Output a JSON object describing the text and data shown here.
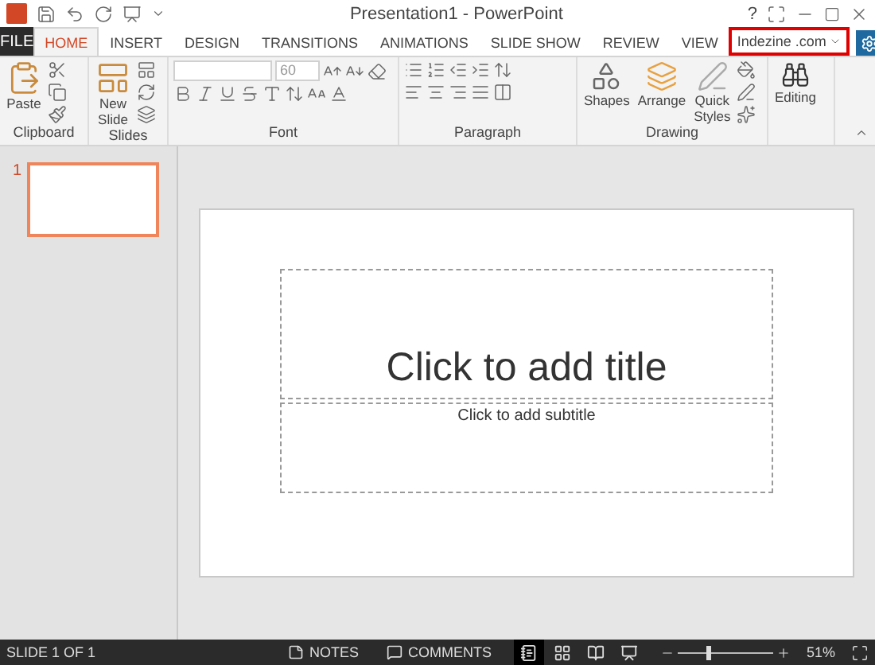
{
  "window": {
    "title": "Presentation1 - PowerPoint",
    "help": "?"
  },
  "file_tab": "FILE",
  "tabs": [
    {
      "label": "HOME",
      "selected": true
    },
    {
      "label": "INSERT",
      "selected": false
    },
    {
      "label": "DESIGN",
      "selected": false
    },
    {
      "label": "TRANSITIONS",
      "selected": false
    },
    {
      "label": "ANIMATIONS",
      "selected": false
    },
    {
      "label": "SLIDE SHOW",
      "selected": false
    },
    {
      "label": "REVIEW",
      "selected": false
    },
    {
      "label": "VIEW",
      "selected": false
    }
  ],
  "account": {
    "name": "Indezine .com",
    "highlighted": true
  },
  "ribbon": {
    "groups": [
      {
        "kind": "clipboard",
        "label": "Clipboard",
        "buttons": [
          "Paste"
        ]
      },
      {
        "kind": "slides",
        "label": "Slides",
        "buttons": [
          "New",
          "Slide"
        ]
      },
      {
        "kind": "font",
        "label": "Font",
        "font_size": "60"
      },
      {
        "kind": "paragraph",
        "label": "Paragraph"
      },
      {
        "kind": "drawing",
        "label": "Drawing",
        "buttons": [
          "Shapes",
          "Arrange",
          "Quick",
          "Styles"
        ]
      },
      {
        "kind": "editing",
        "buttons": [
          "Editing"
        ]
      }
    ]
  },
  "thumbnails": [
    {
      "number": "1",
      "selected": true
    }
  ],
  "slide": {
    "title_placeholder": "Click to add title",
    "subtitle_placeholder": "Click to add subtitle"
  },
  "status_bar": {
    "slide_info": "SLIDE 1 OF 1",
    "notes": "NOTES",
    "comments": "COMMENTS",
    "zoom_slider": {
      "level": 0.3
    },
    "zoom": "51%"
  }
}
